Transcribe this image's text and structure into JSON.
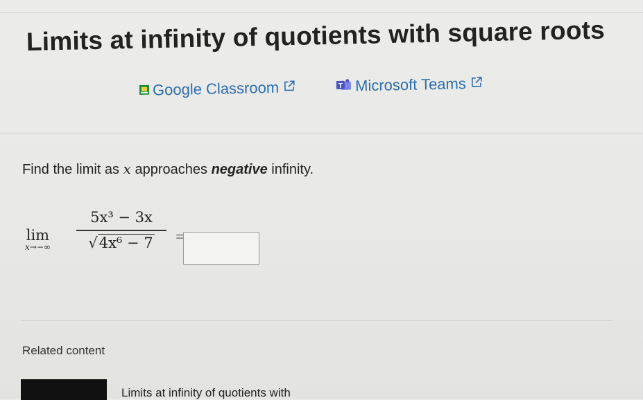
{
  "page": {
    "title": "Limits at infinity of quotients with square roots"
  },
  "share": {
    "google_label": "Google Classroom",
    "teams_label": "Microsoft Teams"
  },
  "question": {
    "prefix": "Find the limit as",
    "variable": "x",
    "middle": "approaches",
    "emphasis": "negative",
    "suffix": "infinity."
  },
  "expression": {
    "lim_word": "lim",
    "lim_sub": "x→−∞",
    "numerator": "5x³ − 3x",
    "denominator_radicand": "4x⁶ − 7",
    "equals": "=",
    "answer_value": ""
  },
  "related": {
    "heading": "Related content",
    "link_text": "Limits at infinity of quotients with"
  },
  "colors": {
    "link": "#2c6fb0",
    "google_icon": "#1e8e3e",
    "teams_icon": "#4b53bc"
  }
}
